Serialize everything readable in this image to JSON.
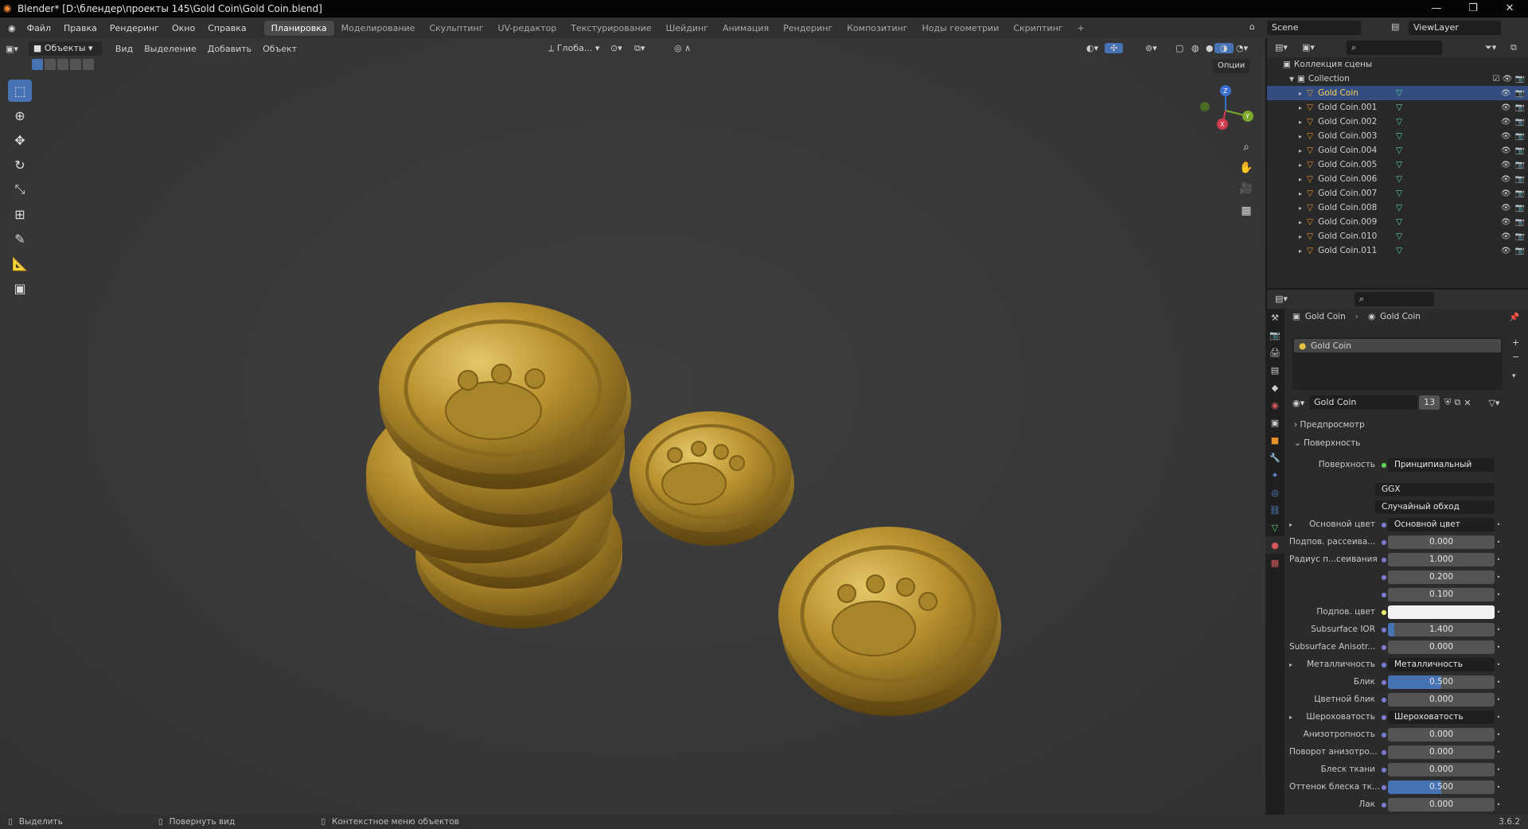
{
  "window": {
    "title": "Blender* [D:\\блендер\\проекты 145\\Gold Coin\\Gold Coin.blend]",
    "controls": [
      "—",
      "❐",
      "✕"
    ]
  },
  "menu": [
    "Файл",
    "Правка",
    "Рендеринг",
    "Окно",
    "Справка"
  ],
  "workspaces": [
    "Планировка",
    "Моделирование",
    "Скульптинг",
    "UV-редактор",
    "Текстурирование",
    "Шейдинг",
    "Анимация",
    "Рендеринг",
    "Композитинг",
    "Ноды геометрии",
    "Скриптинг",
    "+"
  ],
  "scene": {
    "scene_name": "Scene",
    "view_layer": "ViewLayer"
  },
  "viewport_header": {
    "mode": "Объекты",
    "menus": [
      "Вид",
      "Выделение",
      "Добавить",
      "Объект"
    ],
    "transform": "Глоба...",
    "options": "Опции"
  },
  "outliner": {
    "root": "Коллекция сцены",
    "collection": "Collection",
    "items": [
      "Gold Coin",
      "Gold Coin.001",
      "Gold Coin.002",
      "Gold Coin.003",
      "Gold Coin.004",
      "Gold Coin.005",
      "Gold Coin.006",
      "Gold Coin.007",
      "Gold Coin.008",
      "Gold Coin.009",
      "Gold Coin.010",
      "Gold Coin.011"
    ],
    "selected_index": 0
  },
  "properties": {
    "breadcrumb": [
      "Gold Coin",
      "Gold Coin"
    ],
    "slot": "Gold Coin",
    "material_name": "Gold Coin",
    "users": "13",
    "panels": {
      "preview": "Предпросмотр",
      "surface": "Поверхность"
    },
    "surface_label": "Поверхность",
    "surface_value": "Принципиальный BSDF",
    "distribution": "GGX",
    "subsurface_method": "Случайный обход",
    "rows": [
      {
        "label": "Основной цвет",
        "value": "Основной цвет",
        "kind": "link"
      },
      {
        "label": "Подпов. рассеива...",
        "value": "0.000",
        "kind": "num"
      },
      {
        "label": "Радиус п...сеивания",
        "value": "1.000",
        "kind": "num"
      },
      {
        "label": "",
        "value": "0.200",
        "kind": "num"
      },
      {
        "label": "",
        "value": "0.100",
        "kind": "num"
      },
      {
        "label": "Подпов. цвет",
        "value": "",
        "kind": "color"
      },
      {
        "label": "Subsurface IOR",
        "value": "1.400",
        "kind": "bar",
        "fill": 0.06
      },
      {
        "label": "Subsurface Anisotr...",
        "value": "0.000",
        "kind": "num"
      },
      {
        "label": "Металличность",
        "value": "Металличность",
        "kind": "link"
      },
      {
        "label": "Блик",
        "value": "0.500",
        "kind": "bar",
        "fill": 0.5
      },
      {
        "label": "Цветной блик",
        "value": "0.000",
        "kind": "num"
      },
      {
        "label": "Шероховатость",
        "value": "Шероховатость",
        "kind": "link"
      },
      {
        "label": "Анизотропность",
        "value": "0.000",
        "kind": "num"
      },
      {
        "label": "Поворот анизотро...",
        "value": "0.000",
        "kind": "num"
      },
      {
        "label": "Блеск ткани",
        "value": "0.000",
        "kind": "num"
      },
      {
        "label": "Оттенок блеска тк...",
        "value": "0.500",
        "kind": "bar",
        "fill": 0.5
      },
      {
        "label": "Лак",
        "value": "0.000",
        "kind": "num"
      }
    ]
  },
  "status": {
    "select": "Выделить",
    "rotate": "Повернуть вид",
    "context": "Контекстное меню объектов",
    "version": "3.6.2"
  },
  "colors": {
    "accent": "#4772b3",
    "selection": "#334d80",
    "coin": "#b8912e"
  }
}
